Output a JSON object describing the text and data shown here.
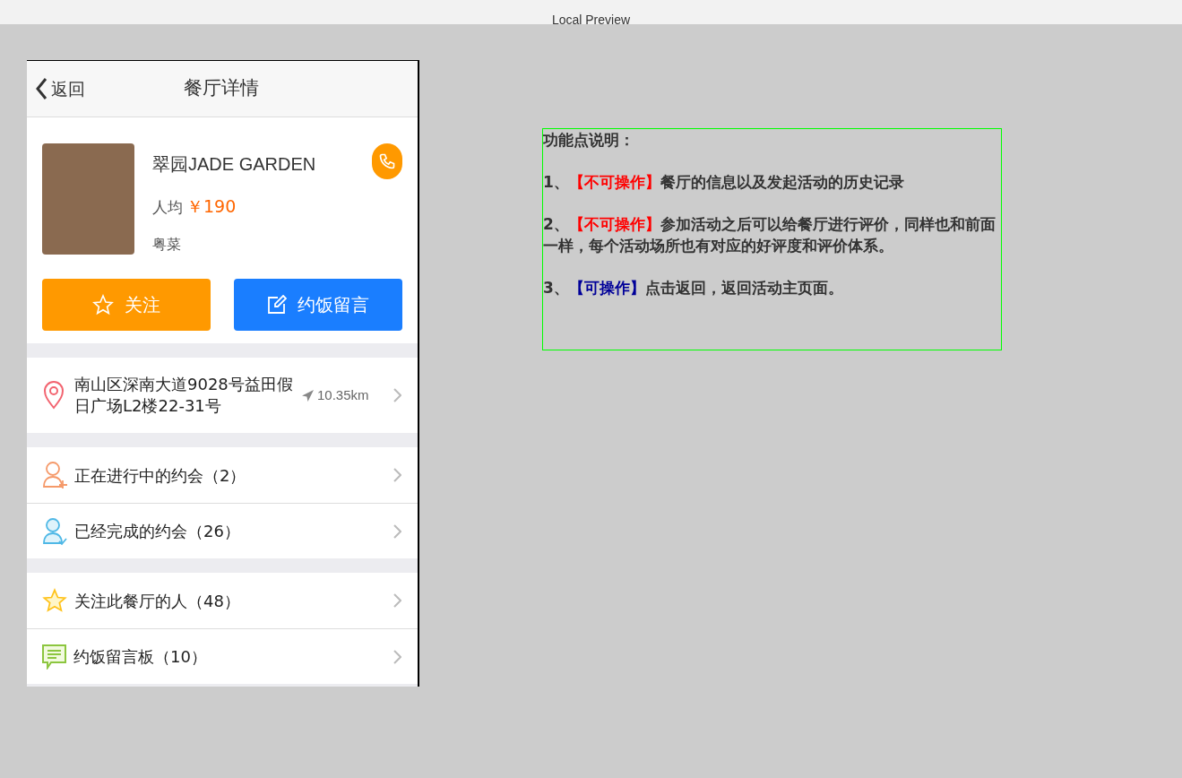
{
  "window": {
    "title": "Local Preview"
  },
  "header": {
    "back": "返回",
    "title": "餐厅详情"
  },
  "restaurant": {
    "name": "翠园JADE GARDEN",
    "price_label": "人均",
    "price": "￥190",
    "cuisine": "粤菜"
  },
  "buttons": [
    {
      "kind": "follow",
      "label": "关注"
    },
    {
      "kind": "message",
      "label": "约饭留言"
    }
  ],
  "address": {
    "text": "南山区深南大道9028号益田假日广场L2楼22-31号",
    "distance": "10.35km"
  },
  "groups": [
    [
      {
        "kind": "person-plus",
        "label": "正在进行中的约会（2）"
      },
      {
        "kind": "person-check",
        "label": "已经完成的约会（26）"
      }
    ],
    [
      {
        "kind": "star",
        "label": "关注此餐厅的人（48）"
      },
      {
        "kind": "message",
        "label": "约饭留言板（10）"
      }
    ]
  ],
  "notes": {
    "title": "功能点说明：",
    "items": [
      {
        "number": "1、",
        "tag": "【不可操作】",
        "color": "#ff0000",
        "text": "餐厅的信息以及发起活动的历史记录"
      },
      {
        "number": "2、",
        "tag": "【不可操作】",
        "color": "#ff0000",
        "text": "参加活动之后可以给餐厅进行评价，同样也和前面一样，每个活动场所也有对应的好评度和评价体系。"
      },
      {
        "number": "3、",
        "tag": "【可操作】",
        "color": "#000099",
        "text": "点击返回，返回活动主页面。"
      }
    ]
  }
}
